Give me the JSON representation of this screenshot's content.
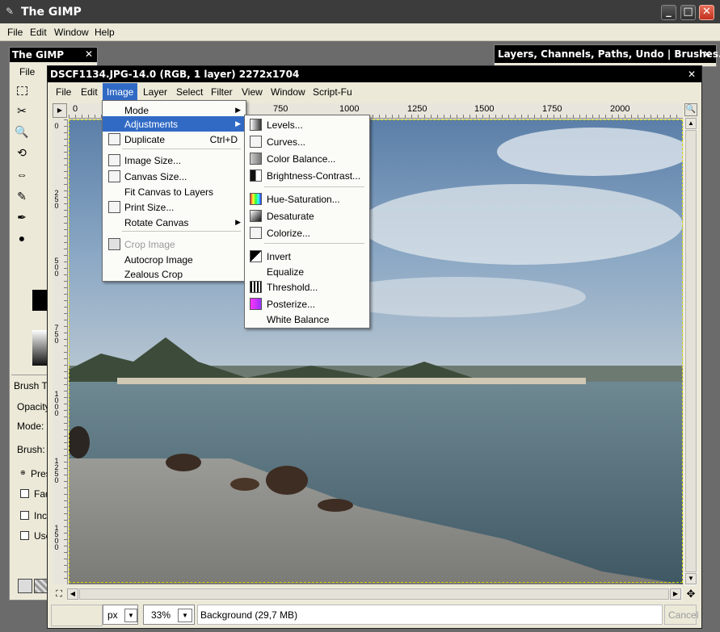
{
  "main_window": {
    "title": "The GIMP",
    "menu": [
      "File",
      "Edit",
      "Window",
      "Help"
    ],
    "min_label": "_",
    "max_label": "□",
    "close_label": "✕"
  },
  "toolbox": {
    "title": "The GIMP",
    "menu_file": "File",
    "close_label": "✕",
    "tool_options": {
      "header": "Brush To",
      "opacity_label": "Opacity",
      "mode_label": "Mode:",
      "brush_label": "Brush:",
      "pressure_label": "Pres",
      "fade_label": "Fad",
      "incremental_label": "Incr",
      "use_label": "Use"
    }
  },
  "layers_dock": {
    "title": "Layers, Channels, Paths, Undo | Brushes...",
    "close_label": "✕"
  },
  "image_window": {
    "title": "DSCF1134.JPG-14.0 (RGB, 1 layer) 2272x1704",
    "close_label": "✕",
    "menu": [
      "File",
      "Edit",
      "Image",
      "Layer",
      "Select",
      "Filter",
      "View",
      "Window",
      "Script-Fu"
    ],
    "active_menu": "Image",
    "ruler_top": [
      "0",
      "750",
      "1000",
      "1250",
      "1500",
      "1750",
      "2000"
    ],
    "ruler_left": [
      {
        "chars": [
          "0"
        ]
      },
      {
        "chars": [
          "2",
          "5",
          "0"
        ]
      },
      {
        "chars": [
          "5",
          "0",
          "0"
        ]
      },
      {
        "chars": [
          "7",
          "5",
          "0"
        ]
      },
      {
        "chars": [
          "1",
          "0",
          "0",
          "0"
        ]
      },
      {
        "chars": [
          "1",
          "2",
          "5",
          "0"
        ]
      },
      {
        "chars": [
          "1",
          "5",
          "0",
          "0"
        ]
      }
    ],
    "status": {
      "unit": "px",
      "zoom": "33%",
      "layer_info": "Background (29,7 MB)",
      "cancel_label": "Cancel"
    }
  },
  "image_menu": {
    "items": [
      {
        "label": "Mode",
        "submenu": true
      },
      {
        "label": "Adjustments",
        "submenu": true,
        "highlighted": true
      },
      {
        "label": "Duplicate",
        "shortcut": "Ctrl+D",
        "icon": "duplicate-icon"
      },
      {
        "label": "Image Size...",
        "icon": "image-size-icon"
      },
      {
        "label": "Canvas Size...",
        "icon": "canvas-size-icon"
      },
      {
        "label": "Fit Canvas to Layers"
      },
      {
        "label": "Print Size...",
        "icon": "print-size-icon"
      },
      {
        "label": "Rotate Canvas",
        "submenu": true
      },
      {
        "label": "Crop Image",
        "disabled": true,
        "icon": "crop-icon"
      },
      {
        "label": "Autocrop Image"
      },
      {
        "label": "Zealous Crop"
      }
    ]
  },
  "adjustments_menu": {
    "items": [
      {
        "label": "Levels...",
        "icon": "levels-icon"
      },
      {
        "label": "Curves...",
        "icon": "curves-icon"
      },
      {
        "label": "Color Balance...",
        "icon": "color-balance-icon"
      },
      {
        "label": "Brightness-Contrast...",
        "icon": "brightness-contrast-icon"
      },
      {
        "label": "Hue-Saturation...",
        "icon": "hue-saturation-icon"
      },
      {
        "label": "Desaturate",
        "icon": "desaturate-icon"
      },
      {
        "label": "Colorize...",
        "icon": "colorize-icon"
      },
      {
        "label": "Invert",
        "icon": "invert-icon"
      },
      {
        "label": "Equalize"
      },
      {
        "label": "Threshold...",
        "icon": "threshold-icon"
      },
      {
        "label": "Posterize...",
        "icon": "posterize-icon"
      },
      {
        "label": "White Balance"
      }
    ]
  },
  "colors": {
    "titlebar": "#3c3c3c",
    "menu_highlight": "#316ac5",
    "menubar_bg": "#ece9d8",
    "close_red": "#d9402b"
  }
}
